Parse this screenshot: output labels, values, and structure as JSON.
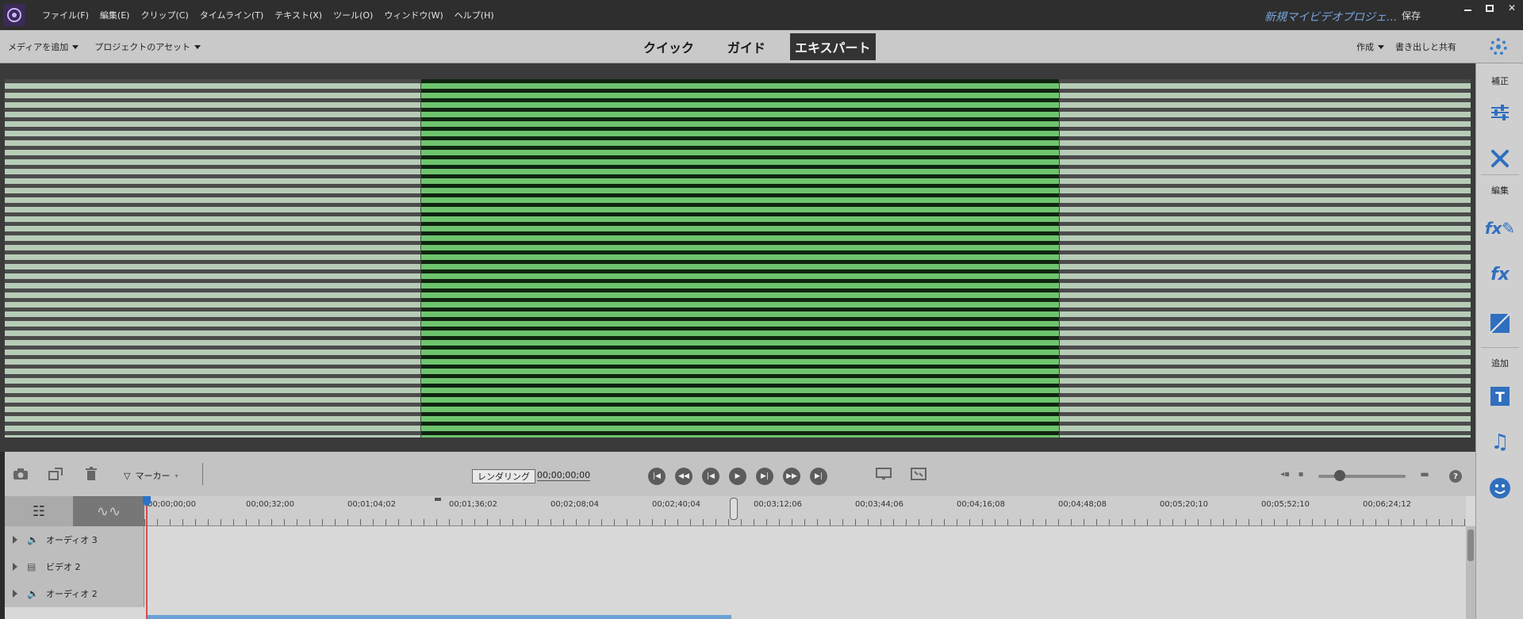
{
  "menu": {
    "items": [
      "ファイル(F)",
      "編集(E)",
      "クリップ(C)",
      "タイムライン(T)",
      "テキスト(X)",
      "ツール(O)",
      "ウィンドウ(W)",
      "ヘルプ(H)"
    ],
    "project_title": "新規マイビデオプロジェ...",
    "save": "保存"
  },
  "toolbar": {
    "add_media": "メディアを追加",
    "project_assets": "プロジェクトのアセット",
    "modes": [
      "クイック",
      "ガイド",
      "エキスパート"
    ],
    "active_mode": "エキスパート",
    "create": "作成",
    "export_share": "書き出しと共有"
  },
  "right_panel": {
    "sections": [
      "補正",
      "編集",
      "追加"
    ],
    "icons": [
      "adjust-sliders-icon",
      "tools-icon",
      "applied-effects-icon",
      "effects-icon",
      "transitions-icon",
      "titles-icon",
      "music-icon",
      "graphics-icon"
    ]
  },
  "transport": {
    "marker": "マーカー",
    "render": "レンダリング",
    "timecode": "00;00;00;00"
  },
  "timeline": {
    "ruler": [
      "00;00;00;00",
      "00;00;32;00",
      "00;01;04;02",
      "00;01;36;02",
      "00;02;08;04",
      "00;02;40;04",
      "00;03;12;06",
      "00;03;44;06",
      "00;04;16;08",
      "00;04;48;08",
      "00;05;20;10",
      "00;05;52;10",
      "00;06;24;12"
    ],
    "tracks": [
      {
        "label": "オーディオ 3",
        "type": "audio"
      },
      {
        "label": "ビデオ 2",
        "type": "video"
      },
      {
        "label": "オーディオ 2",
        "type": "audio"
      }
    ]
  },
  "colors": {
    "accent": "#3f7ec8",
    "playhead": "#d05050",
    "preview_green": "#6ec46e"
  }
}
